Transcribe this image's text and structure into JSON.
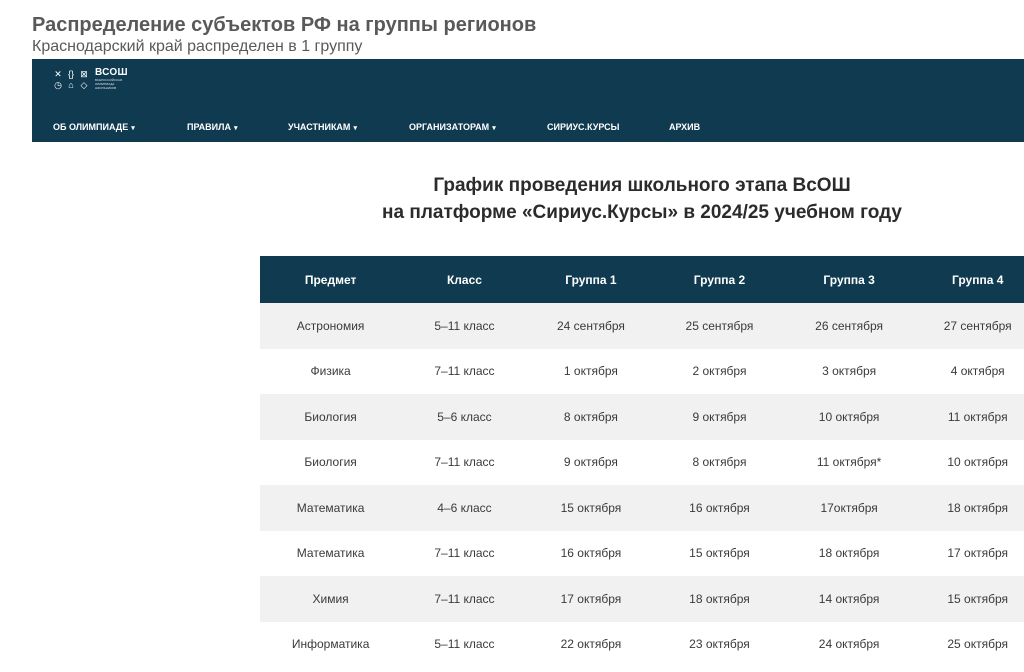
{
  "header": {
    "title": "Распределение субъектов РФ на группы регионов",
    "subtitle": "Краснодарский край распределен в 1 группу"
  },
  "site": {
    "logo_text": "ВСОШ",
    "logo_subtext": "ВСЕРОССИЙСКАЯ ОЛИМПИАДА ШКОЛЬНИКОВ",
    "nav": [
      {
        "label": "ОБ ОЛИМПИАДЕ",
        "has_dropdown": true
      },
      {
        "label": "ПРАВИЛА",
        "has_dropdown": true
      },
      {
        "label": "УЧАСТНИКАМ",
        "has_dropdown": true
      },
      {
        "label": "ОРГАНИЗАТОРАМ",
        "has_dropdown": true
      },
      {
        "label": "СИРИУС.КУРСЫ",
        "has_dropdown": false
      },
      {
        "label": "АРХИВ",
        "has_dropdown": false
      }
    ]
  },
  "schedule": {
    "title_line1": "График проведения школьного этапа ВсОШ",
    "title_line2": "на платформе «Сириус.Курсы» в 2024/25 учебном году",
    "columns": [
      "Предмет",
      "Класс",
      "Группа 1",
      "Группа 2",
      "Группа 3",
      "Группа 4"
    ],
    "rows": [
      [
        "Астрономия",
        "5–11 класс",
        "24 сентября",
        "25 сентября",
        "26 сентября",
        "27 сентября"
      ],
      [
        "Физика",
        "7–11 класс",
        "1 октября",
        "2 октября",
        "3 октября",
        "4 октября"
      ],
      [
        "Биология",
        "5–6 класс",
        "8 октября",
        "9 октября",
        "10 октября",
        "11 октября"
      ],
      [
        "Биология",
        "7–11 класс",
        "9 октября",
        "8 октября",
        "11 октября*",
        "10 октября"
      ],
      [
        "Математика",
        "4–6 класс",
        "15 октября",
        "16 октября",
        "17октября",
        "18 октября"
      ],
      [
        "Математика",
        "7–11 класс",
        "16 октября",
        "15 октября",
        "18 октября",
        "17 октября"
      ],
      [
        "Химия",
        "7–11 класс",
        "17 октября",
        "18 октября",
        "14 октября",
        "15 октября"
      ],
      [
        "Информатика",
        "5–11 класс",
        "22 октября",
        "23 октября",
        "24 октября",
        "25 октября"
      ]
    ]
  },
  "colors": {
    "brand_navy": "#0f3a50",
    "row_stripe": "#f1f1f1",
    "header_text": "#595959"
  }
}
